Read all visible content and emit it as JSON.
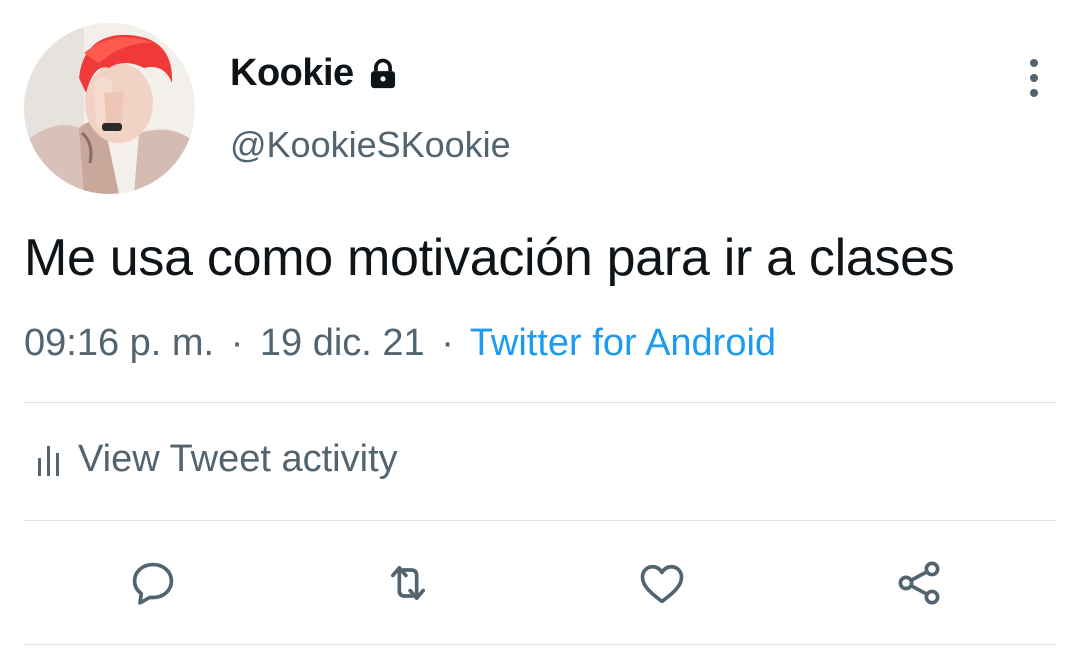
{
  "user": {
    "display_name": "Kookie",
    "handle": "@KookieSKookie",
    "protected_icon": "lock-icon",
    "avatar_icon": "profile-avatar"
  },
  "tweet": {
    "text": "Me usa como motivación para ir a clases",
    "time": "09:16 p. m.",
    "separator": "·",
    "date": "19 dic. 21",
    "source": "Twitter for Android"
  },
  "activity": {
    "label": "View Tweet activity",
    "icon": "bar-chart-icon"
  },
  "actions": {
    "icons": [
      "reply-icon",
      "retweet-icon",
      "like-icon",
      "share-icon"
    ]
  },
  "menu": {
    "icon": "more-vertical-icon"
  },
  "colors": {
    "text": "#0f1419",
    "secondary": "#536471",
    "link": "#1d9bf0",
    "divider": "#dfe3e6",
    "background": "#ffffff"
  }
}
